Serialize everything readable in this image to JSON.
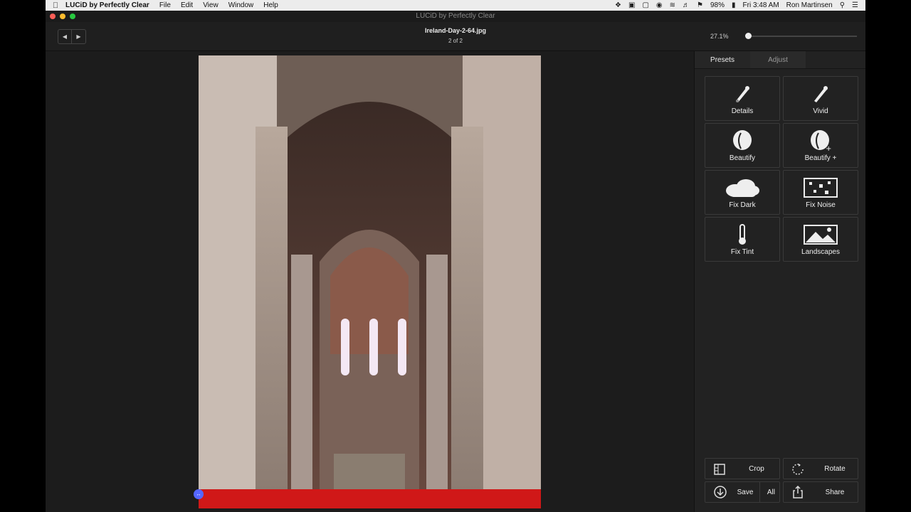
{
  "menubar": {
    "app_name": "LUCiD by Perfectly Clear",
    "menus": [
      "File",
      "Edit",
      "View",
      "Window",
      "Help"
    ],
    "battery": "98%",
    "clock": "Fri 3:48 AM",
    "user": "Ron Martinsen"
  },
  "window": {
    "title": "LUCiD by Perfectly Clear"
  },
  "toolbar": {
    "file_name": "Ireland-Day-2-64.jpg",
    "file_count": "2 of 2",
    "zoom_label": "27.1%",
    "zoom_level": 0.02
  },
  "panel": {
    "tabs": [
      {
        "label": "Presets",
        "active": true
      },
      {
        "label": "Adjust",
        "active": false
      }
    ],
    "presets": [
      {
        "label": "Details",
        "icon": "brush-icon"
      },
      {
        "label": "Vivid",
        "icon": "brush-icon"
      },
      {
        "label": "Beautify",
        "icon": "face-icon"
      },
      {
        "label": "Beautify +",
        "icon": "face-plus-icon"
      },
      {
        "label": "Fix Dark",
        "icon": "cloud-icon"
      },
      {
        "label": "Fix Noise",
        "icon": "noise-icon"
      },
      {
        "label": "Fix Tint",
        "icon": "thermometer-icon"
      },
      {
        "label": "Landscapes",
        "icon": "landscape-icon"
      }
    ],
    "actions": {
      "crop": "Crop",
      "rotate": "Rotate",
      "save": "Save",
      "save_all": "All",
      "share": "Share"
    }
  },
  "colors": {
    "accent": "#5566ff",
    "background": "#1d1d1d",
    "panel": "#222222"
  }
}
